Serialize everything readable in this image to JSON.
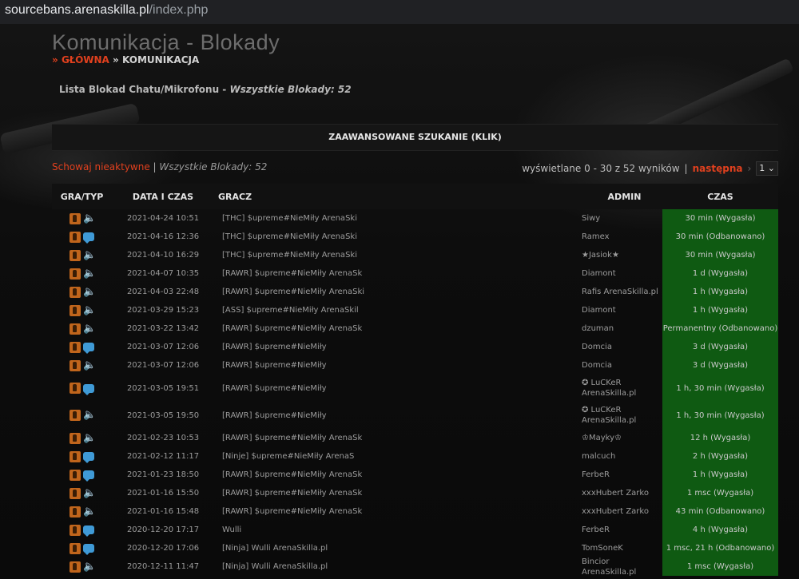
{
  "browser": {
    "url_prefix": "sourcebans.",
    "url_host": "arenaskilla.pl",
    "url_path": "/index.php"
  },
  "page": {
    "title": "Komunikacja - Blokady",
    "breadcrumb": {
      "sep1": "»",
      "home": "GŁÓWNA",
      "sep2": "»",
      "current": "KOMUNIKACJA"
    },
    "subtitle": {
      "label": "Lista Blokad Chatu/Mikrofonu",
      "dash": " - ",
      "count": "Wszystkie Blokady: 52"
    }
  },
  "advanced_search": {
    "label": "ZAAWANSOWANE SZUKANIE (KLIK)"
  },
  "filters": {
    "hide_inactive": "Schowaj nieaktywne",
    "separator": " | ",
    "all_count": "Wszystkie Blokady: 52"
  },
  "pagination": {
    "info": "wyświetlane 0 - 30 z 52 wyników",
    "separator": "|",
    "next": "następna",
    "arrow": "›",
    "page": "1",
    "page_arrow": "⌄"
  },
  "table": {
    "headers": {
      "type": "GRA/TYP",
      "date": "DATA I CZAS",
      "player": "GRACZ",
      "admin": "ADMIN",
      "time": "CZAS"
    },
    "rows": [
      {
        "kind": "mute",
        "date": "2021-04-24 10:51",
        "player": "[THC] $upreme#NieMiły ArenaSki",
        "admin": "Siwy",
        "time": "30 min (Wygasła)"
      },
      {
        "kind": "chat",
        "date": "2021-04-16 12:36",
        "player": "[THC] $upreme#NieMiły ArenaSki",
        "admin": "Ramex",
        "time": "30 min (Odbanowano)"
      },
      {
        "kind": "mute",
        "date": "2021-04-10 16:29",
        "player": "[THC] $upreme#NieMiły ArenaSki",
        "admin": "★Jasiok★",
        "time": "30 min (Wygasła)"
      },
      {
        "kind": "mute",
        "date": "2021-04-07 10:35",
        "player": "[RAWR] $upreme#NieMiły ArenaSk",
        "admin": "Diamont",
        "time": "1 d (Wygasła)"
      },
      {
        "kind": "mute",
        "date": "2021-04-03 22:48",
        "player": "[RAWR] $upreme#NieMiły ArenaSki",
        "admin": "Rafis ArenaSkilla.pl",
        "time": "1 h (Wygasła)"
      },
      {
        "kind": "mute",
        "date": "2021-03-29 15:23",
        "player": "[ASS] $upreme#NieMiły ArenaSkil",
        "admin": "Diamont",
        "time": "1 h (Wygasła)"
      },
      {
        "kind": "mute",
        "date": "2021-03-22 13:42",
        "player": "[RAWR] $upreme#NieMiły ArenaSk",
        "admin": "dzuman",
        "time": "Permanentny (Odbanowano)"
      },
      {
        "kind": "chat",
        "date": "2021-03-07 12:06",
        "player": "[RAWR] $upreme#NieMiły",
        "admin": "Domcia",
        "time": "3 d (Wygasła)"
      },
      {
        "kind": "mute",
        "date": "2021-03-07 12:06",
        "player": "[RAWR] $upreme#NieMiły",
        "admin": "Domcia",
        "time": "3 d (Wygasła)"
      },
      {
        "kind": "chat",
        "date": "2021-03-05 19:51",
        "player": "[RAWR] $upreme#NieMiły",
        "admin": "✪ LuCKeR ArenaSkilla.pl",
        "time": "1 h, 30 min (Wygasła)"
      },
      {
        "kind": "mute",
        "date": "2021-03-05 19:50",
        "player": "[RAWR] $upreme#NieMiły",
        "admin": "✪ LuCKeR ArenaSkilla.pl",
        "time": "1 h, 30 min (Wygasła)"
      },
      {
        "kind": "mute",
        "date": "2021-02-23 10:53",
        "player": "[RAWR] $upreme#NieMiły ArenaSk",
        "admin": "♔Mayky♔",
        "time": "12 h (Wygasła)"
      },
      {
        "kind": "chat",
        "date": "2021-02-12 11:17",
        "player": "[Ninje] $upreme#NieMiły ArenaS",
        "admin": "malcuch",
        "time": "2 h (Wygasła)"
      },
      {
        "kind": "chat",
        "date": "2021-01-23 18:50",
        "player": "[RAWR] $upreme#NieMiły ArenaSk",
        "admin": "FerbeR",
        "time": "1 h (Wygasła)"
      },
      {
        "kind": "mute",
        "date": "2021-01-16 15:50",
        "player": "[RAWR] $upreme#NieMiły ArenaSk",
        "admin": "xxxHubert Zarko",
        "time": "1 msc (Wygasła)"
      },
      {
        "kind": "mute",
        "date": "2021-01-16 15:48",
        "player": "[RAWR] $upreme#NieMiły ArenaSk",
        "admin": "xxxHubert Zarko",
        "time": "43 min (Odbanowano)"
      },
      {
        "kind": "chat",
        "date": "2020-12-20 17:17",
        "player": "Wulli",
        "admin": "FerbeR",
        "time": "4 h (Wygasła)"
      },
      {
        "kind": "chat",
        "date": "2020-12-20 17:06",
        "player": "[Ninja] Wulli ArenaSkilla.pl",
        "admin": "TomSoneK",
        "time": "1 msc, 21 h (Odbanowano)"
      },
      {
        "kind": "mute",
        "date": "2020-12-11 11:47",
        "player": "[Ninja] Wulli ArenaSkilla.pl",
        "admin": "Bincior ArenaSkilla.pl",
        "time": "1 msc (Wygasła)"
      }
    ]
  },
  "colors": {
    "accent": "#e0401e",
    "time_cell_bg": "#0f5a12",
    "mute_icon": "#e8552a",
    "chat_icon": "#3f9ad6",
    "game_icon": "#c0651c"
  }
}
